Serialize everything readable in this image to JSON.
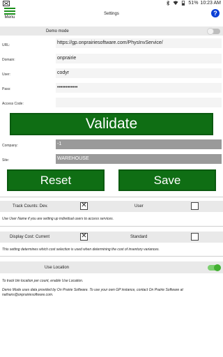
{
  "statusbar": {
    "battery_text": "51%",
    "time": "10:23 AM"
  },
  "header": {
    "menu_label": "Menu",
    "title": "Settings",
    "help_label": "?"
  },
  "demo_mode": {
    "label": "Demo mode",
    "enabled": false
  },
  "fields": {
    "url": {
      "label": "URL:",
      "value": "https://gp.onprairiesoftware.com/PhysInvService/"
    },
    "domain": {
      "label": "Domain:",
      "value": "onprairie"
    },
    "user": {
      "label": "User:",
      "value": "codyr"
    },
    "pass": {
      "label": "Pass:",
      "value": "••••••••••••"
    },
    "access_code": {
      "label": "Access Code:",
      "value": ""
    }
  },
  "buttons": {
    "validate": "Validate",
    "reset": "Reset",
    "save": "Save"
  },
  "company": {
    "label": "Company:",
    "value": "-1"
  },
  "site": {
    "label": "Site:",
    "value": "WAREHOUSE"
  },
  "track_counts": {
    "label": "Track Counts: Dev.",
    "dev_checked": true,
    "user_label": "User",
    "user_checked": false,
    "hint": "Use User Name if you are setting up individual users to access services."
  },
  "display_cost": {
    "label": "Display Cost: Current",
    "current_checked": true,
    "standard_label": "Standard",
    "standard_checked": false,
    "hint": "This setting determines which cost selection is used when determining the cost of inventory variances."
  },
  "use_location": {
    "label": "Use Location",
    "enabled": true,
    "hint": "To track bin location per count, enable Use Location."
  },
  "demo_note": "Demo Mode uses data provided by On Prairie Software. To use your own GP instance, contact On Prairie Software at nathans@onprairiesoftware.com."
}
